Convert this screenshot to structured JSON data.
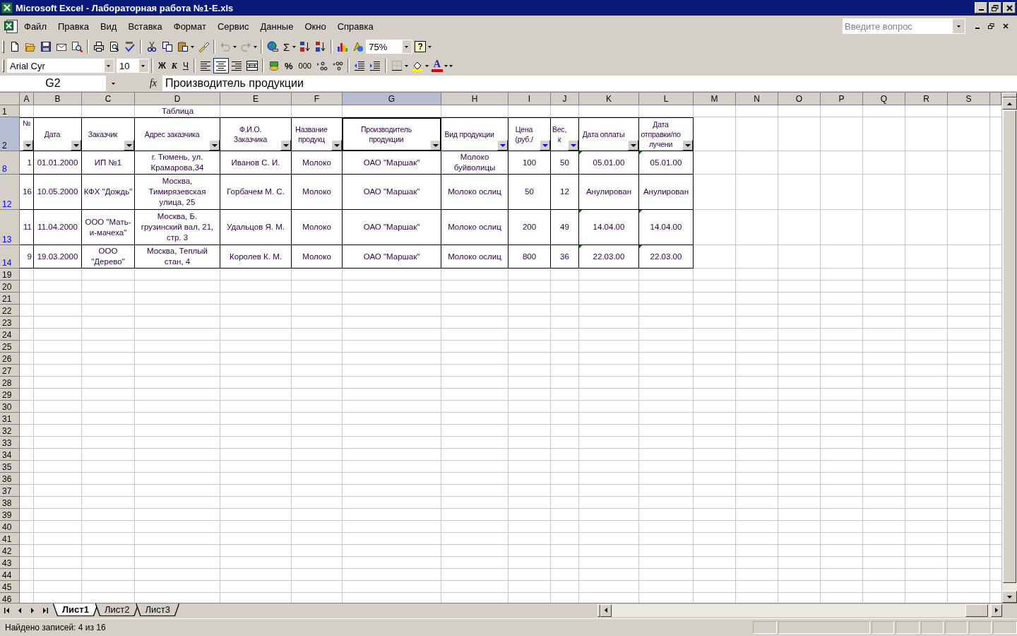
{
  "window": {
    "title": "Microsoft Excel - Лабораторная работа №1-E.xls"
  },
  "menu": [
    "Файл",
    "Правка",
    "Вид",
    "Вставка",
    "Формат",
    "Сервис",
    "Данные",
    "Окно",
    "Справка"
  ],
  "help_box": {
    "placeholder": "Введите вопрос"
  },
  "standard_toolbar": {
    "autosum": "Σ",
    "zoom": "75%",
    "help": "?",
    "undo": {
      "disabled": true
    },
    "redo": {
      "disabled": true
    }
  },
  "formatting_toolbar": {
    "font": "Arial Cyr",
    "size": "10",
    "bold": "Ж",
    "italic": "К",
    "underline": "Ч",
    "alignment_buttons": [
      {
        "kind": "left",
        "pressed": false
      },
      {
        "kind": "center",
        "pressed": true
      },
      {
        "kind": "right",
        "pressed": false
      }
    ],
    "percent": "%",
    "thousands": "000",
    "font_color": "A"
  },
  "formula_bar": {
    "name_box": "G2",
    "function_label": "fx",
    "content": "Производитель продукции"
  },
  "sheet": {
    "columns": [
      {
        "label": "A",
        "selected": false
      },
      {
        "label": "B",
        "selected": false
      },
      {
        "label": "C",
        "selected": false
      },
      {
        "label": "D",
        "selected": false
      },
      {
        "label": "E",
        "selected": false
      },
      {
        "label": "F",
        "selected": false
      },
      {
        "label": "G",
        "selected": true
      },
      {
        "label": "H",
        "selected": false
      },
      {
        "label": "I",
        "selected": false
      },
      {
        "label": "J",
        "selected": false
      },
      {
        "label": "K",
        "selected": false
      },
      {
        "label": "L",
        "selected": false
      },
      {
        "label": "M",
        "selected": false
      },
      {
        "label": "N",
        "selected": false
      },
      {
        "label": "O",
        "selected": false
      },
      {
        "label": "P",
        "selected": false
      },
      {
        "label": "Q",
        "selected": false
      },
      {
        "label": "R",
        "selected": false
      },
      {
        "label": "S",
        "selected": false
      }
    ],
    "title_row": {
      "number": "1",
      "cells": [
        null,
        null,
        null,
        "Таблица"
      ]
    },
    "header_row": {
      "number": "2",
      "selected": true,
      "headers": [
        {
          "text": "№",
          "filtered": false,
          "selected": false
        },
        {
          "text": "Дата",
          "filtered": false,
          "selected": false
        },
        {
          "text": "Заказчик",
          "filtered": false,
          "selected": false
        },
        {
          "text": "Адрес заказчика",
          "filtered": false,
          "selected": false
        },
        {
          "text": "Ф.И.О.\nЗаказчика",
          "filtered": false,
          "selected": false
        },
        {
          "text": "Название\nпродукц",
          "filtered": false,
          "selected": false
        },
        {
          "text": "Производитель\nпродукции",
          "filtered": false,
          "selected": true
        },
        {
          "text": "Вид продукции",
          "filtered": true,
          "selected": false
        },
        {
          "text": "Цена\n(руб./",
          "filtered": true,
          "selected": false
        },
        {
          "text": "Вес,\nк",
          "filtered": true,
          "selected": false
        },
        {
          "text": "Дата оплаты",
          "filtered": false,
          "selected": false
        },
        {
          "text": "Дата\nотправки/по\nлучени",
          "filtered": false,
          "selected": false
        }
      ]
    },
    "rows": [
      {
        "number": "8",
        "filtered": true,
        "error_marks": true,
        "cells": [
          "1",
          "01.01.2000",
          "ИП №1",
          "г. Тюмень, ул. Крамарова,34",
          "Иванов С. И.",
          "Молоко",
          "ОАО \"Маршак\"",
          "Молоко буйволицы",
          "100",
          "50",
          "05.01.00",
          "05.01.00"
        ]
      },
      {
        "number": "12",
        "filtered": true,
        "error_marks": false,
        "cells": [
          "16",
          "10.05.2000",
          "КФХ \"Дождь\"",
          "Москва, Тимирязевская улица, 25",
          "Горбачем М. С.",
          "Молоко",
          "ОАО \"Маршак\"",
          "Молоко ослиц",
          "50",
          "12",
          "Анулирован",
          "Анулирован"
        ]
      },
      {
        "number": "13",
        "filtered": true,
        "error_marks": true,
        "cells": [
          "11",
          "11.04.2000",
          "ООО \"Мать-и-мачеха\"",
          "Москва, Б. грузинский вал, 21, стр. 3",
          "Удальцов Я. М.",
          "Молоко",
          "ОАО \"Маршак\"",
          "Молоко ослиц",
          "200",
          "49",
          "14.04.00",
          "14.04.00"
        ]
      },
      {
        "number": "14",
        "filtered": true,
        "error_marks": true,
        "cells": [
          "9",
          "19.03.2000",
          "ООО \"Дерево\"",
          "Москва, Теплый стан, 4",
          "Королев К. М.",
          "Молоко",
          "ОАО \"Маршак\"",
          "Молоко ослиц",
          "800",
          "36",
          "22.03.00",
          "22.03.00"
        ]
      }
    ],
    "empty_rows": [
      "19",
      "20",
      "21",
      "22",
      "23",
      "24",
      "25",
      "26",
      "27",
      "28",
      "29",
      "30",
      "31",
      "32",
      "33",
      "34",
      "35",
      "36",
      "37",
      "38",
      "39",
      "40",
      "41",
      "42",
      "43",
      "44",
      "45",
      "46"
    ]
  },
  "sheet_tabs": [
    {
      "label": "Лист1",
      "selected": true
    },
    {
      "label": "Лист2",
      "selected": false
    },
    {
      "label": "Лист3",
      "selected": false
    }
  ],
  "status_bar": {
    "text": "Найдено записей: 4 из 16"
  }
}
